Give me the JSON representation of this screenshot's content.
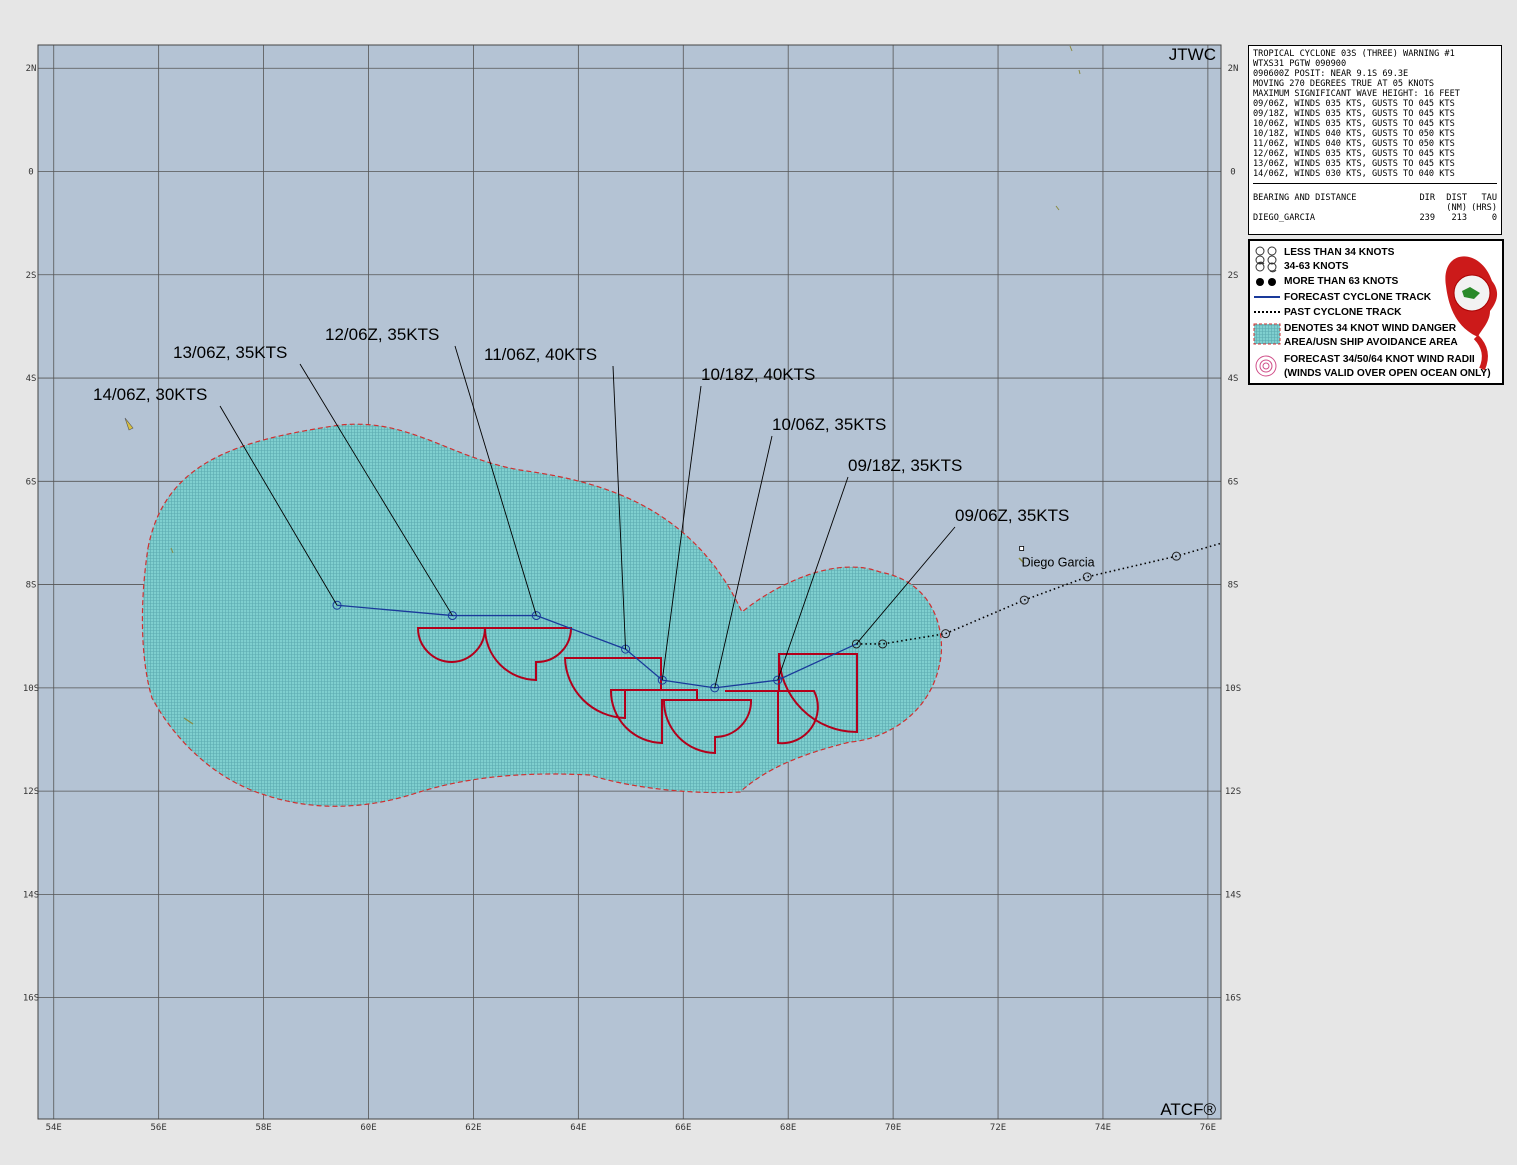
{
  "map": {
    "corner_top": "JTWC",
    "corner_bottom": "ATCF®",
    "lon_range": [
      53.7,
      76.25
    ],
    "lat_range": [
      -18.35,
      2.45
    ],
    "lon_labels": [
      "54E",
      "56E",
      "58E",
      "60E",
      "62E",
      "64E",
      "66E",
      "68E",
      "70E",
      "72E",
      "74E",
      "76E"
    ],
    "lat_labels": [
      "2N",
      "0",
      "2S",
      "4S",
      "6S",
      "8S",
      "10S",
      "12S",
      "14S",
      "16S"
    ],
    "place": {
      "name": "Diego Garcia",
      "lon": 72.45,
      "lat": -7.3
    },
    "colors": {
      "ocean": "#b4c3d4",
      "grid": "#555555",
      "danger_fill": "#7fcfcf",
      "danger_edge": "#d03030",
      "track": "#1a3a9a",
      "radii": "#b3001b"
    }
  },
  "chart_data": {
    "type": "track_map",
    "forecast_track": [
      {
        "label": "09/06Z, 35KTS",
        "lon": 69.3,
        "lat": -9.15
      },
      {
        "label": "09/18Z, 35KTS",
        "lon": 67.8,
        "lat": -9.85
      },
      {
        "label": "10/06Z, 35KTS",
        "lon": 66.6,
        "lat": -10.0
      },
      {
        "label": "10/18Z, 40KTS",
        "lon": 65.6,
        "lat": -9.85
      },
      {
        "label": "11/06Z, 40KTS",
        "lon": 64.9,
        "lat": -9.25
      },
      {
        "label": "12/06Z, 35KTS",
        "lon": 63.2,
        "lat": -8.6
      },
      {
        "label": "13/06Z, 35KTS",
        "lon": 61.6,
        "lat": -8.6
      },
      {
        "label": "14/06Z, 30KTS",
        "lon": 59.4,
        "lat": -8.4
      }
    ],
    "past_track": [
      {
        "lon": 69.3,
        "lat": -9.15
      },
      {
        "lon": 69.8,
        "lat": -9.15
      },
      {
        "lon": 71.0,
        "lat": -8.95
      },
      {
        "lon": 72.5,
        "lat": -8.3
      },
      {
        "lon": 73.7,
        "lat": -7.85
      },
      {
        "lon": 75.4,
        "lat": -7.45
      },
      {
        "lon": 76.25,
        "lat": -7.2
      }
    ]
  },
  "warning": {
    "lines": [
      "TROPICAL CYCLONE 03S (THREE) WARNING #1",
      "WTXS31 PGTW 090900",
      "090600Z POSIT: NEAR 9.1S 69.3E",
      "MOVING 270 DEGREES TRUE AT 05 KNOTS",
      "MAXIMUM SIGNIFICANT WAVE HEIGHT: 16 FEET",
      "09/06Z, WINDS 035 KTS, GUSTS TO 045 KTS",
      "09/18Z, WINDS 035 KTS, GUSTS TO 045 KTS",
      "10/06Z, WINDS 035 KTS, GUSTS TO 045 KTS",
      "10/18Z, WINDS 040 KTS, GUSTS TO 050 KTS",
      "11/06Z, WINDS 040 KTS, GUSTS TO 050 KTS",
      "12/06Z, WINDS 035 KTS, GUSTS TO 045 KTS",
      "13/06Z, WINDS 035 KTS, GUSTS TO 045 KTS",
      "14/06Z, WINDS 030 KTS, GUSTS TO 040 KTS"
    ],
    "bearing_header": {
      "label": "BEARING AND DISTANCE",
      "dir": "DIR",
      "dist": "DIST",
      "tau": "TAU"
    },
    "bearing_units": {
      "dist": "(NM)",
      "tau": "(HRS)"
    },
    "bearing_row": {
      "place": "DIEGO_GARCIA",
      "dir": "239",
      "dist": "213",
      "tau": "0"
    }
  },
  "legend": {
    "items": [
      "LESS THAN 34 KNOTS",
      "34-63 KNOTS",
      "MORE THAN 63 KNOTS",
      "FORECAST CYCLONE TRACK",
      "PAST CYCLONE TRACK",
      "DENOTES 34 KNOT WIND DANGER",
      "AREA/USN SHIP AVOIDANCE AREA",
      "FORECAST 34/50/64 KNOT WIND RADII",
      "(WINDS VALID OVER OPEN OCEAN ONLY)"
    ]
  }
}
